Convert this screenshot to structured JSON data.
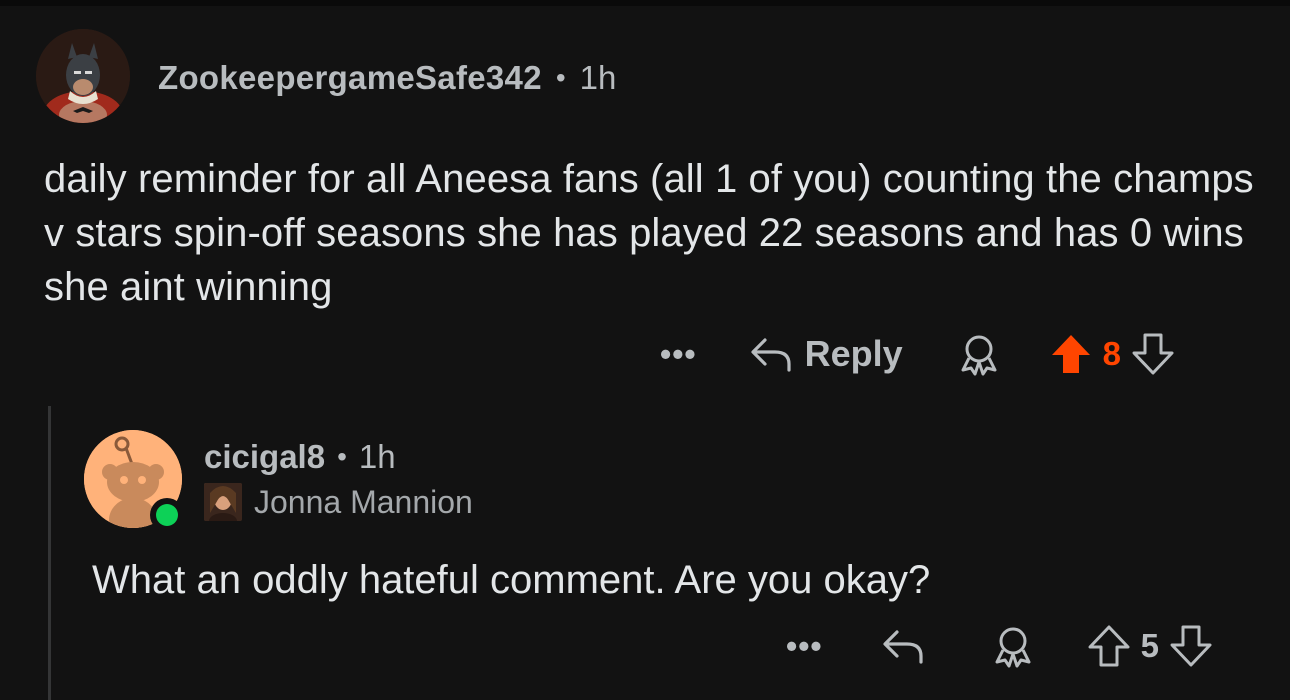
{
  "comment": {
    "username": "ZookeepergameSafe342",
    "separator": "•",
    "time": "1h",
    "avatar_icon": "batman-avatar",
    "body": "daily reminder for all Aneesa fans (all 1 of you) counting the champs v stars spin-off seasons she has played 22 seasons and has 0 wins she aint winning",
    "more_label": "•••",
    "reply_label": "Reply",
    "score": "8",
    "upvoted": true,
    "upvote_color": "#ff4500"
  },
  "reply": {
    "username": "cicigal8",
    "separator": "•",
    "time": "1h",
    "avatar_icon": "snoo-avatar",
    "online": true,
    "flair_text": "Jonna Mannion",
    "body": "What an oddly hateful comment. Are you okay?",
    "more_label": "•••",
    "score": "5",
    "upvoted": false
  },
  "colors": {
    "background": "#121212",
    "text": "#e3e6e8",
    "muted": "#b8bcbf",
    "online_dot": "#0dd157",
    "avatar_bg": "#ffb27a"
  }
}
